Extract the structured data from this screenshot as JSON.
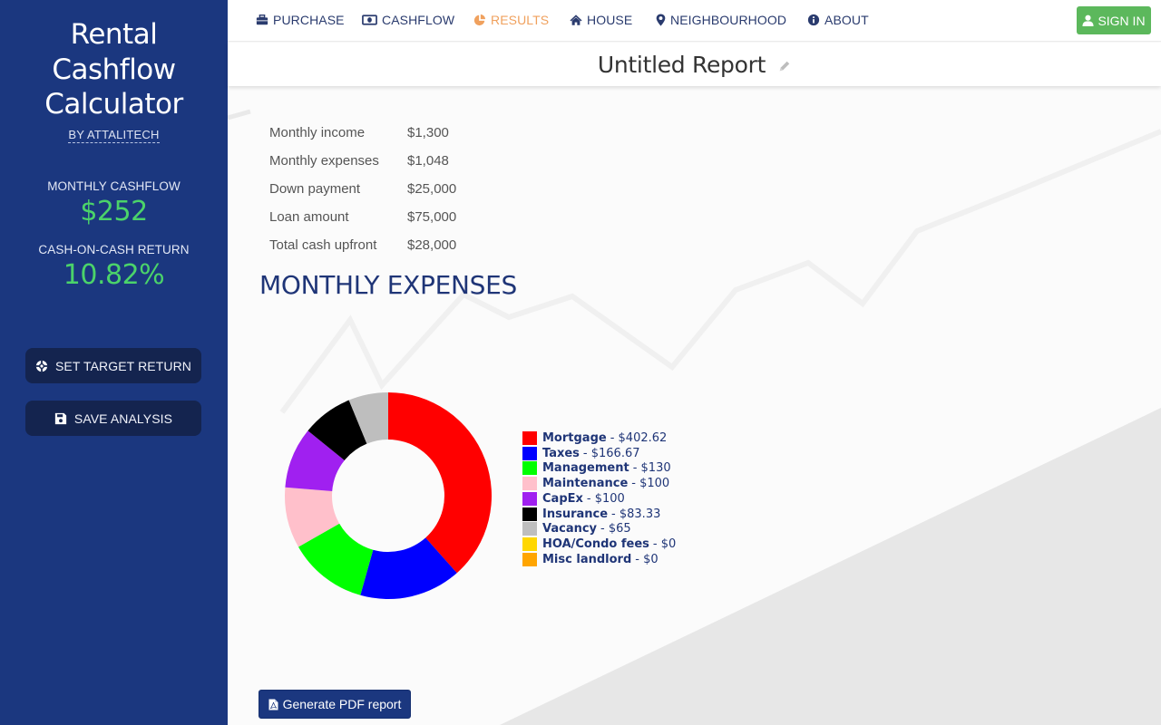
{
  "sidebar": {
    "app_title_lines": [
      "Rental",
      "Cashflow",
      "Calculator"
    ],
    "byline": "BY ATTALITECH",
    "monthly_cashflow_label": "MONTHLY CASHFLOW",
    "monthly_cashflow_value": "$252",
    "coc_label": "CASH-ON-CASH RETURN",
    "coc_value": "10.82%",
    "set_target_label": "SET TARGET RETURN",
    "set_target_icon": "crosshairs-icon",
    "save_label": "SAVE ANALYSIS",
    "save_icon": "floppy-disk-icon"
  },
  "nav": {
    "items": [
      {
        "label": "PURCHASE",
        "icon": "briefcase-icon",
        "active": false
      },
      {
        "label": "CASHFLOW",
        "icon": "money-bill-icon",
        "active": false
      },
      {
        "label": "RESULTS",
        "icon": "pie-chart-icon",
        "active": true
      },
      {
        "label": "HOUSE",
        "icon": "home-icon",
        "active": false
      },
      {
        "label": "NEIGHBOURHOOD",
        "icon": "map-marker-icon",
        "active": false
      },
      {
        "label": "ABOUT",
        "icon": "info-circle-icon",
        "active": false
      }
    ],
    "sign_in_label": "SIGN IN",
    "sign_in_icon": "user-icon"
  },
  "report": {
    "title": "Untitled Report",
    "edit_icon": "pencil-icon"
  },
  "summary": [
    {
      "label": "Monthly income",
      "value": "$1,300"
    },
    {
      "label": "Monthly expenses",
      "value": "$1,048"
    },
    {
      "label": "Down payment",
      "value": "$25,000"
    },
    {
      "label": "Loan amount",
      "value": "$75,000"
    },
    {
      "label": "Total cash upfront",
      "value": "$28,000"
    }
  ],
  "section_title": "MONTHLY EXPENSES",
  "pdf_button_label": "Generate PDF report",
  "colors": {
    "sidebar_bg": "#1b377f",
    "accent_green": "#4bd36a",
    "nav_active": "#f0a15e",
    "sign_in_bg": "#5cb85c"
  },
  "chart_data": {
    "type": "pie",
    "donut": true,
    "title": "MONTHLY EXPENSES",
    "legend_position": "right",
    "categories": [
      "Mortgage",
      "Taxes",
      "Management",
      "Maintenance",
      "CapEx",
      "Insurance",
      "Vacancy",
      "HOA/Condo fees",
      "Misc landlord"
    ],
    "values": [
      402.62,
      166.67,
      130,
      100,
      100,
      83.33,
      65,
      0,
      0
    ],
    "value_labels": [
      "$402.62",
      "$166.67",
      "$130",
      "$100",
      "$100",
      "$83.33",
      "$65",
      "$0",
      "$0"
    ],
    "colors": [
      "#ff0000",
      "#0000ff",
      "#00ff00",
      "#ffc0cb",
      "#a020f0",
      "#000000",
      "#bebebe",
      "#ffd700",
      "#ffa500"
    ]
  }
}
